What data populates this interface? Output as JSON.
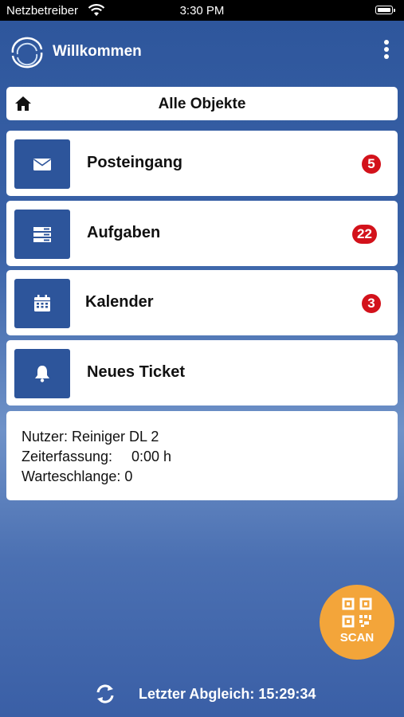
{
  "status_bar": {
    "carrier": "Netzbetreiber",
    "time": "3:30 PM"
  },
  "app_bar": {
    "title": "Willkommen"
  },
  "home_bar": {
    "label": "Alle Objekte"
  },
  "menu": [
    {
      "label": "Posteingang",
      "badge": "5",
      "icon": "mail-icon"
    },
    {
      "label": "Aufgaben",
      "badge": "22",
      "icon": "list-icon"
    },
    {
      "label": "Kalender",
      "badge": "3",
      "icon": "calendar-icon"
    },
    {
      "label": "Neues Ticket",
      "icon": "bell-icon"
    }
  ],
  "info": {
    "user": "Nutzer: Reiniger DL 2",
    "time_label": "Zeiterfassung:",
    "time_value": "0:00 h",
    "queue": "Warteschlange: 0"
  },
  "scan": {
    "label": "SCAN",
    "icon": "qr-code-icon"
  },
  "footer": {
    "label": "Letzter Abgleich: 15:29:34",
    "icon": "sync-icon"
  },
  "colors": {
    "primary": "#2d559b",
    "badge": "#d3121b",
    "scan": "#f3a53a"
  }
}
